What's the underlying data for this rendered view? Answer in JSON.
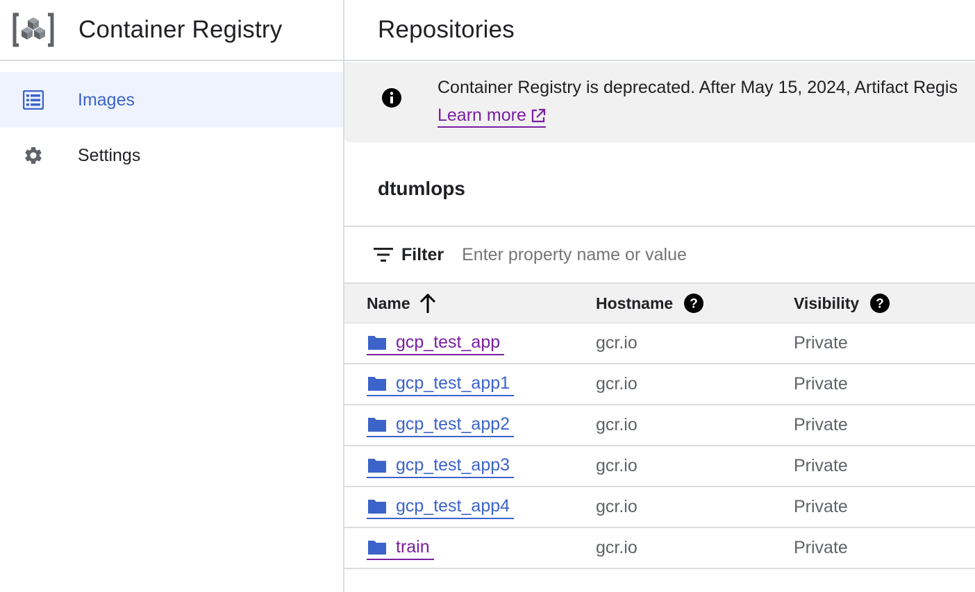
{
  "app": {
    "title": "Container Registry"
  },
  "sidebar": {
    "items": [
      {
        "label": "Images",
        "icon": "list-icon",
        "active": true
      },
      {
        "label": "Settings",
        "icon": "gear-icon",
        "active": false
      }
    ]
  },
  "header": {
    "title": "Repositories"
  },
  "banner": {
    "icon": "info-icon",
    "text": "Container Registry is deprecated. After May 15, 2024, Artifact Regis",
    "link_label": "Learn more"
  },
  "repository": {
    "name": "dtumlops"
  },
  "filter": {
    "label": "Filter",
    "placeholder": "Enter property name or value"
  },
  "table": {
    "columns": [
      "Name",
      "Hostname",
      "Visibility"
    ],
    "rows": [
      {
        "name": "gcp_test_app",
        "hostname": "gcr.io",
        "visibility": "Private",
        "visited": true
      },
      {
        "name": "gcp_test_app1",
        "hostname": "gcr.io",
        "visibility": "Private",
        "visited": false
      },
      {
        "name": "gcp_test_app2",
        "hostname": "gcr.io",
        "visibility": "Private",
        "visited": false
      },
      {
        "name": "gcp_test_app3",
        "hostname": "gcr.io",
        "visibility": "Private",
        "visited": false
      },
      {
        "name": "gcp_test_app4",
        "hostname": "gcr.io",
        "visibility": "Private",
        "visited": false
      },
      {
        "name": "train",
        "hostname": "gcr.io",
        "visibility": "Private",
        "visited": true
      }
    ]
  },
  "colors": {
    "accent_blue": "#3b63c9",
    "visited_purple": "#7a1ea1",
    "active_bg": "#eef3fd",
    "banner_bg": "#f1f1f1"
  }
}
